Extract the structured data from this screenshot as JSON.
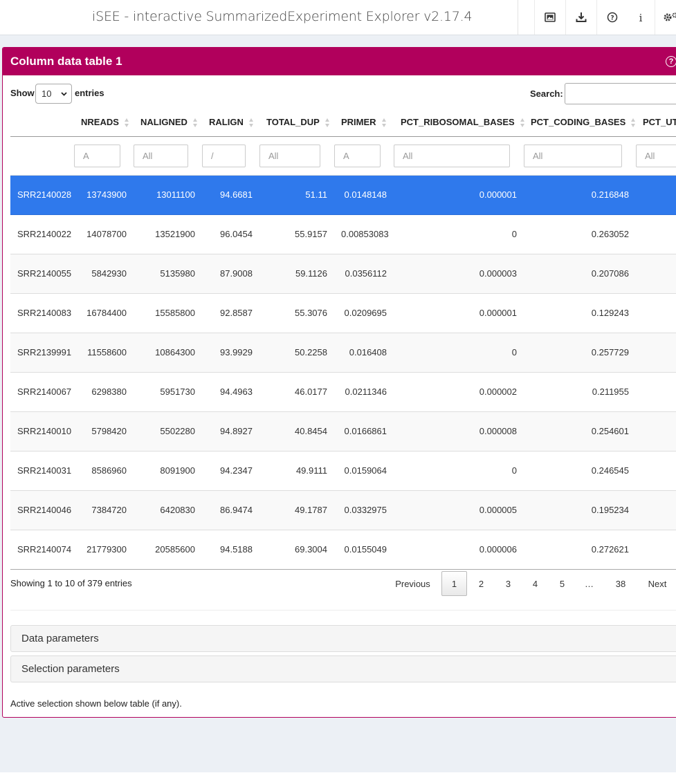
{
  "header": {
    "title": "iSEE - interactive SummarizedExperiment Explorer v2.17.4",
    "icons": [
      "image-download-icon",
      "download-icon",
      "question-circle-icon",
      "info-icon",
      "cogs-icon"
    ]
  },
  "panel": {
    "title": "Column data table 1",
    "accent_color": "#b1005c",
    "show_label": "Show",
    "entries_label": "entries",
    "page_length": "10",
    "search_label": "Search:",
    "search_value": "",
    "columns": [
      "",
      "NREADS",
      "NALIGNED",
      "RALIGN",
      "TOTAL_DUP",
      "PRIMER",
      "PCT_RIBOSOMAL_BASES",
      "PCT_CODING_BASES",
      "PCT_UT"
    ],
    "filters": [
      "",
      "A",
      "All",
      "/",
      "All",
      "A",
      "All",
      "All",
      "All"
    ],
    "rows": [
      {
        "id": "SRR2140028",
        "cells": [
          "13743900",
          "13011100",
          "94.6681",
          "51.11",
          "0.0148148",
          "0.000001",
          "0.216848",
          ""
        ],
        "selected": true
      },
      {
        "id": "SRR2140022",
        "cells": [
          "14078700",
          "13521900",
          "96.0454",
          "55.9157",
          "0.00853083",
          "0",
          "0.263052",
          ""
        ]
      },
      {
        "id": "SRR2140055",
        "cells": [
          "5842930",
          "5135980",
          "87.9008",
          "59.1126",
          "0.0356112",
          "0.000003",
          "0.207086",
          ""
        ]
      },
      {
        "id": "SRR2140083",
        "cells": [
          "16784400",
          "15585800",
          "92.8587",
          "55.3076",
          "0.0209695",
          "0.000001",
          "0.129243",
          ""
        ]
      },
      {
        "id": "SRR2139991",
        "cells": [
          "11558600",
          "10864300",
          "93.9929",
          "50.2258",
          "0.016408",
          "0",
          "0.257729",
          ""
        ]
      },
      {
        "id": "SRR2140067",
        "cells": [
          "6298380",
          "5951730",
          "94.4963",
          "46.0177",
          "0.0211346",
          "0.000002",
          "0.211955",
          ""
        ]
      },
      {
        "id": "SRR2140010",
        "cells": [
          "5798420",
          "5502280",
          "94.8927",
          "40.8454",
          "0.0166861",
          "0.000008",
          "0.254601",
          ""
        ]
      },
      {
        "id": "SRR2140031",
        "cells": [
          "8586960",
          "8091900",
          "94.2347",
          "49.9111",
          "0.0159064",
          "0",
          "0.246545",
          ""
        ]
      },
      {
        "id": "SRR2140046",
        "cells": [
          "7384720",
          "6420830",
          "86.9474",
          "49.1787",
          "0.0332975",
          "0.000005",
          "0.195234",
          ""
        ]
      },
      {
        "id": "SRR2140074",
        "cells": [
          "21779300",
          "20585600",
          "94.5188",
          "69.3004",
          "0.0155049",
          "0.000006",
          "0.272621",
          ""
        ]
      }
    ],
    "info_text": "Showing 1 to 10 of 379 entries",
    "pagination": {
      "previous": "Previous",
      "pages": [
        "1",
        "2",
        "3",
        "4",
        "5",
        "…",
        "38"
      ],
      "current": "1",
      "next": "Next"
    },
    "sections": [
      "Data parameters",
      "Selection parameters"
    ],
    "footnote": "Active selection shown below table (if any)."
  },
  "colors": {
    "selected_row": "#2f79ec",
    "panel_header": "#b1005c",
    "background": "#ecf0f5"
  }
}
